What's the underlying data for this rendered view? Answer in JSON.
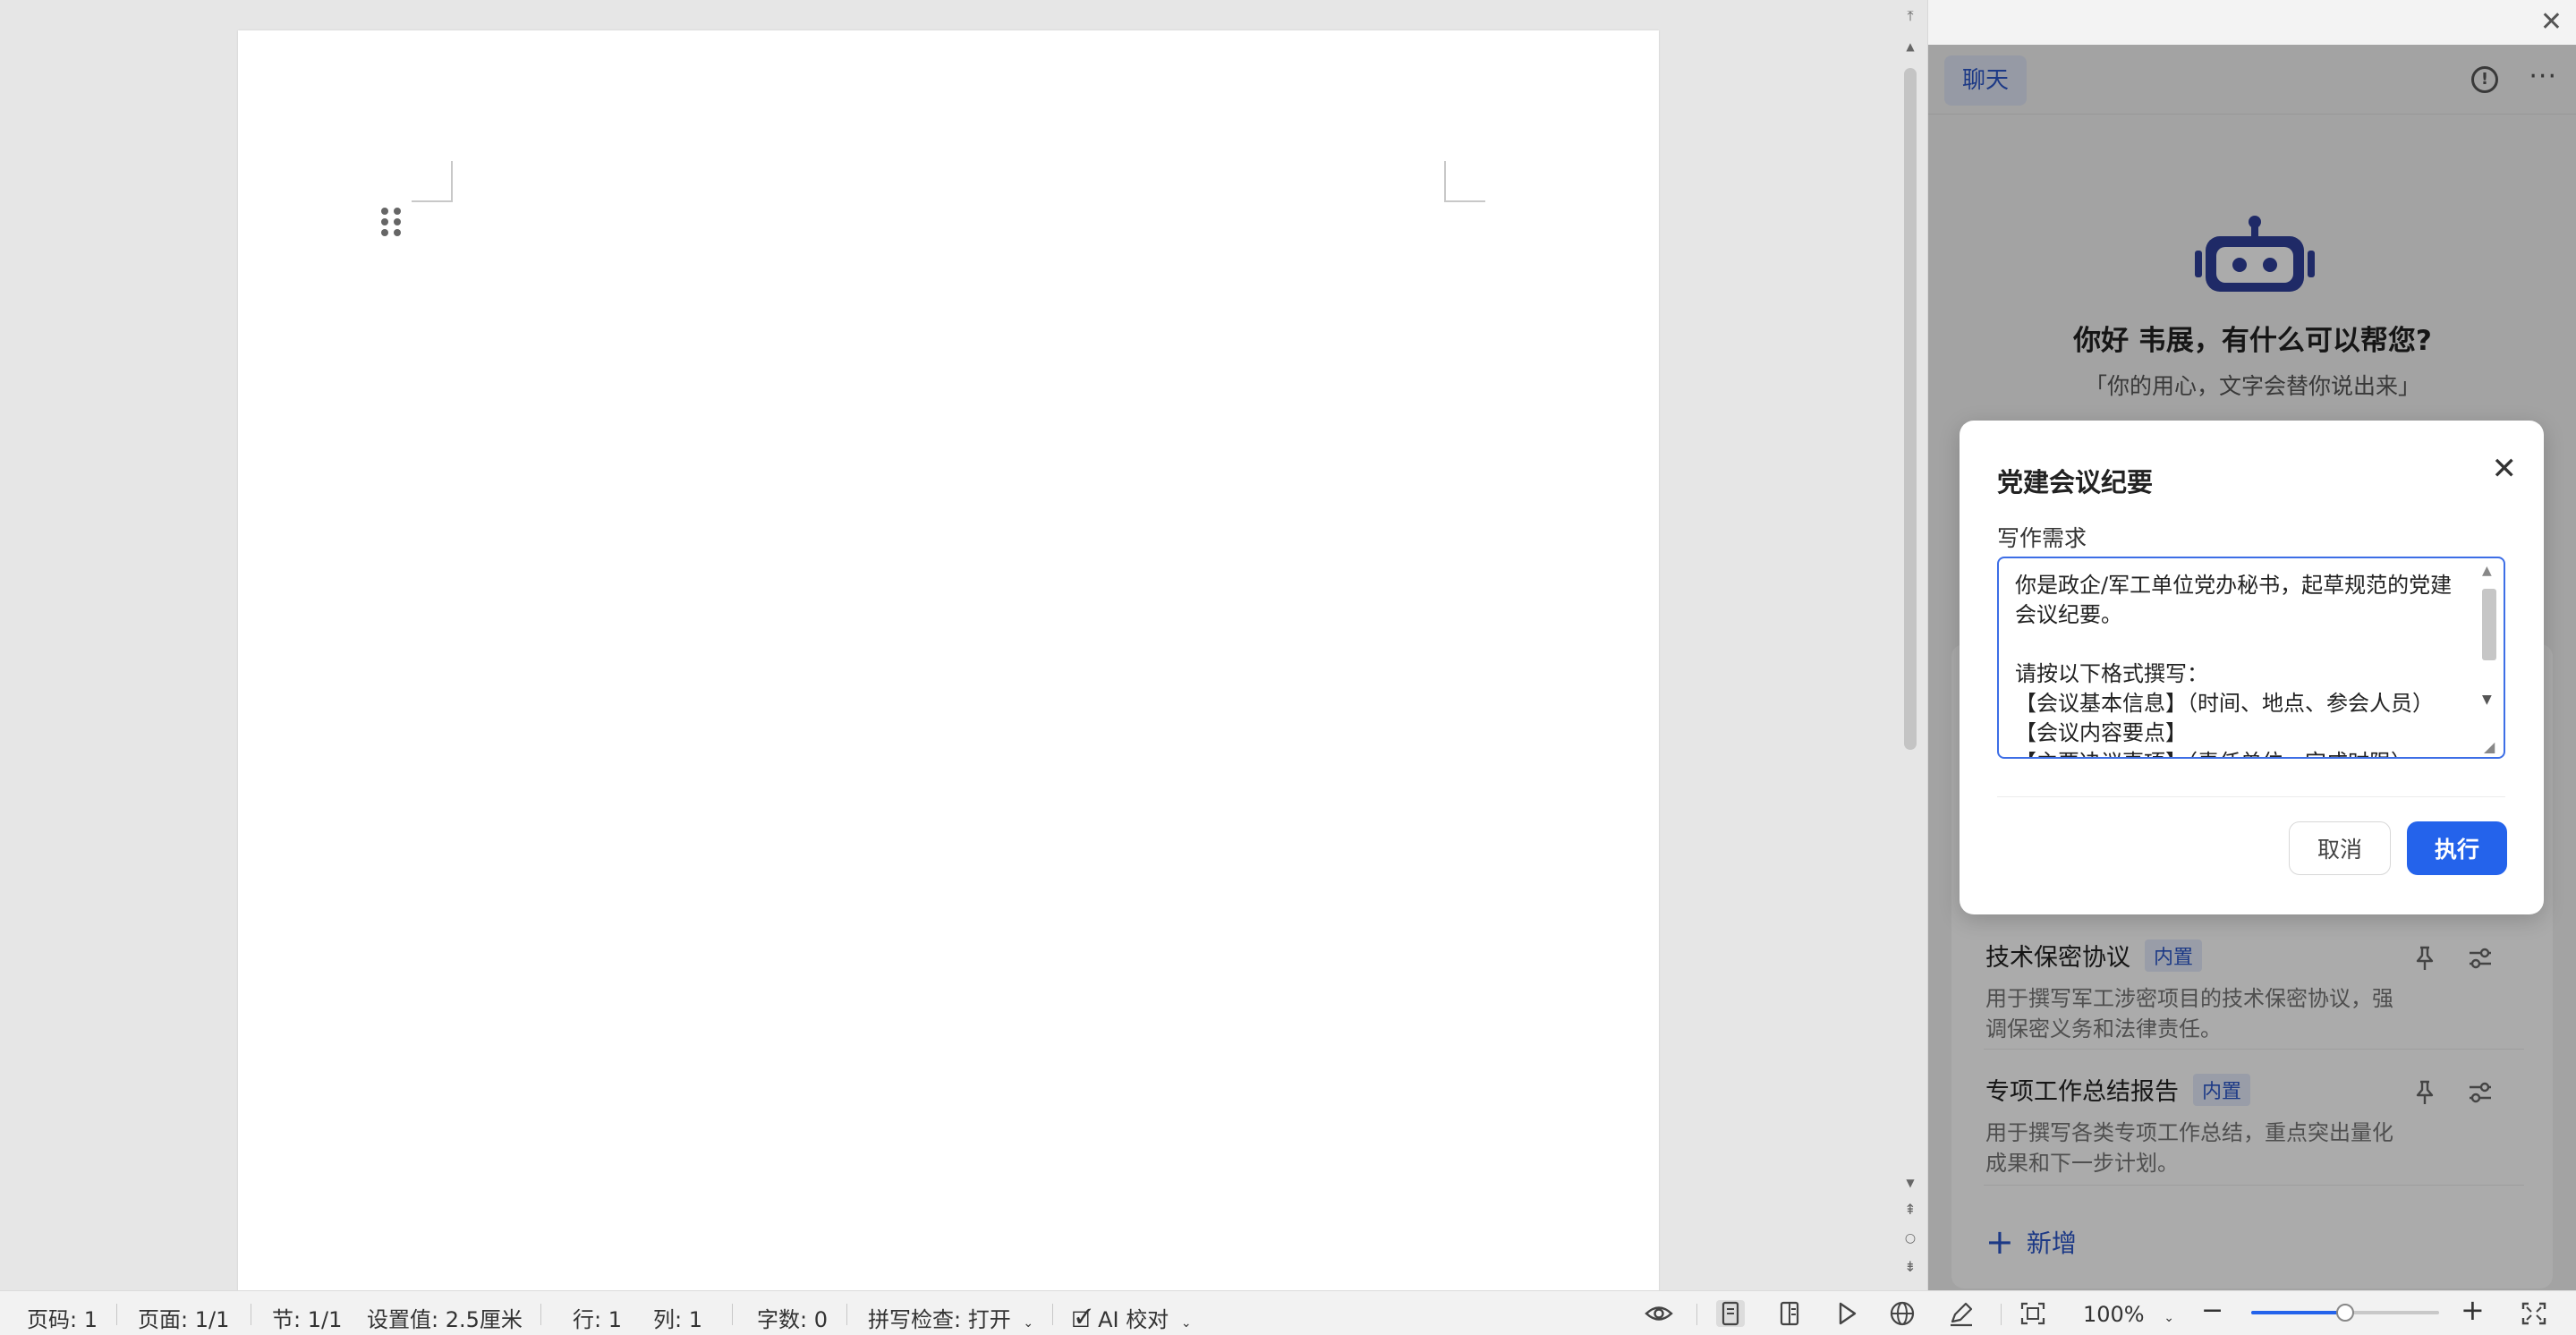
{
  "side_panel": {
    "chat_tab": "聊天",
    "greeting": "你好 韦展，有什么可以帮您?",
    "tagline": "「你的用心，文字会替你说出来」",
    "templates": [
      {
        "title": "技术保密协议",
        "badge": "内置",
        "description": "用于撰写军工涉密项目的技术保密协议，强调保密义务和法律责任。"
      },
      {
        "title": "专项工作总结报告",
        "badge": "内置",
        "description": "用于撰写各类专项工作总结，重点突出量化成果和下一步计划。"
      }
    ],
    "add_new": "新增"
  },
  "dialog": {
    "title": "党建会议纪要",
    "requirement_label": "写作需求",
    "requirement_text": "你是政企/军工单位党办秘书，起草规范的党建会议纪要。\n\n请按以下格式撰写：\n【会议基本信息】（时间、地点、参会人员）\n【会议内容要点】\n【主要决议事项】（责任单位、完成时限）",
    "cancel": "取消",
    "execute": "执行"
  },
  "statusbar": {
    "page_code": "页码: 1",
    "page": "页面: 1/1",
    "section": "节: 1/1",
    "setting": "设置值: 2.5厘米",
    "row": "行: 1",
    "col": "列: 1",
    "word_count": "字数: 0",
    "spell_check": "拼写检查: 打开",
    "ai_proofread": "AI 校对",
    "zoom": "100%",
    "zoom_level": 0.5
  },
  "colors": {
    "accent": "#2463eb",
    "badge_bg": "#e4ebfb",
    "robot": "#2f3f9a"
  }
}
